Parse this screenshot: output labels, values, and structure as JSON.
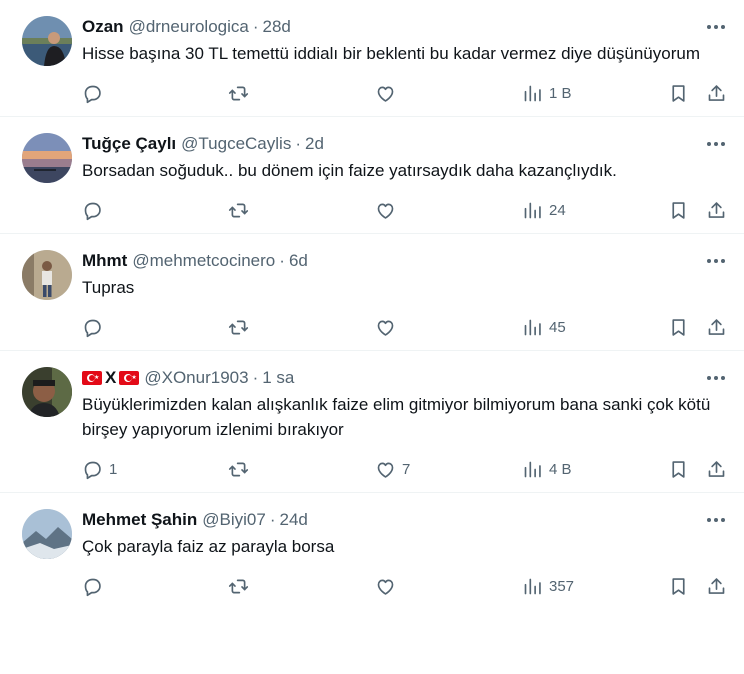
{
  "tweets": [
    {
      "name": "Ozan",
      "handle": "@drneurologica",
      "sep": "·",
      "time": "28d",
      "text": "Hisse başına 30 TL temettü iddialı bir beklenti bu kadar vermez diye düşünüyorum",
      "replies": "",
      "retweets": "",
      "likes": "",
      "views": "1 B",
      "avatar_icon": "avatar-person-lake"
    },
    {
      "name": "Tuğçe Çaylı",
      "handle": "@TugceCaylis",
      "sep": "·",
      "time": "2d",
      "text": "Borsadan soğuduk.. bu dönem için faize yatırsaydık daha kazançlıydık.",
      "replies": "",
      "retweets": "",
      "likes": "",
      "views": "24",
      "avatar_icon": "avatar-sunset"
    },
    {
      "name": "Mhmt",
      "handle": "@mehmetcocinero",
      "sep": "·",
      "time": "6d",
      "text": "Tupras",
      "replies": "",
      "retweets": "",
      "likes": "",
      "views": "45",
      "avatar_icon": "avatar-person-standing"
    },
    {
      "name": "X",
      "handle": "@XOnur1903",
      "sep": "·",
      "time": "1 sa",
      "text": "Büyüklerimizden kalan alışkanlık faize elim gitmiyor bilmiyorum bana sanki çok kötü birşey yapıyorum izlenimi bırakıyor",
      "replies": "1",
      "retweets": "",
      "likes": "7",
      "views": "4 B",
      "avatar_icon": "avatar-person-face"
    },
    {
      "name": "Mehmet Şahin",
      "handle": "@Biyi07",
      "sep": "·",
      "time": "24d",
      "text": "Çok parayla faiz az parayla borsa",
      "replies": "",
      "retweets": "",
      "likes": "",
      "views": "357",
      "avatar_icon": "avatar-mountain"
    }
  ]
}
